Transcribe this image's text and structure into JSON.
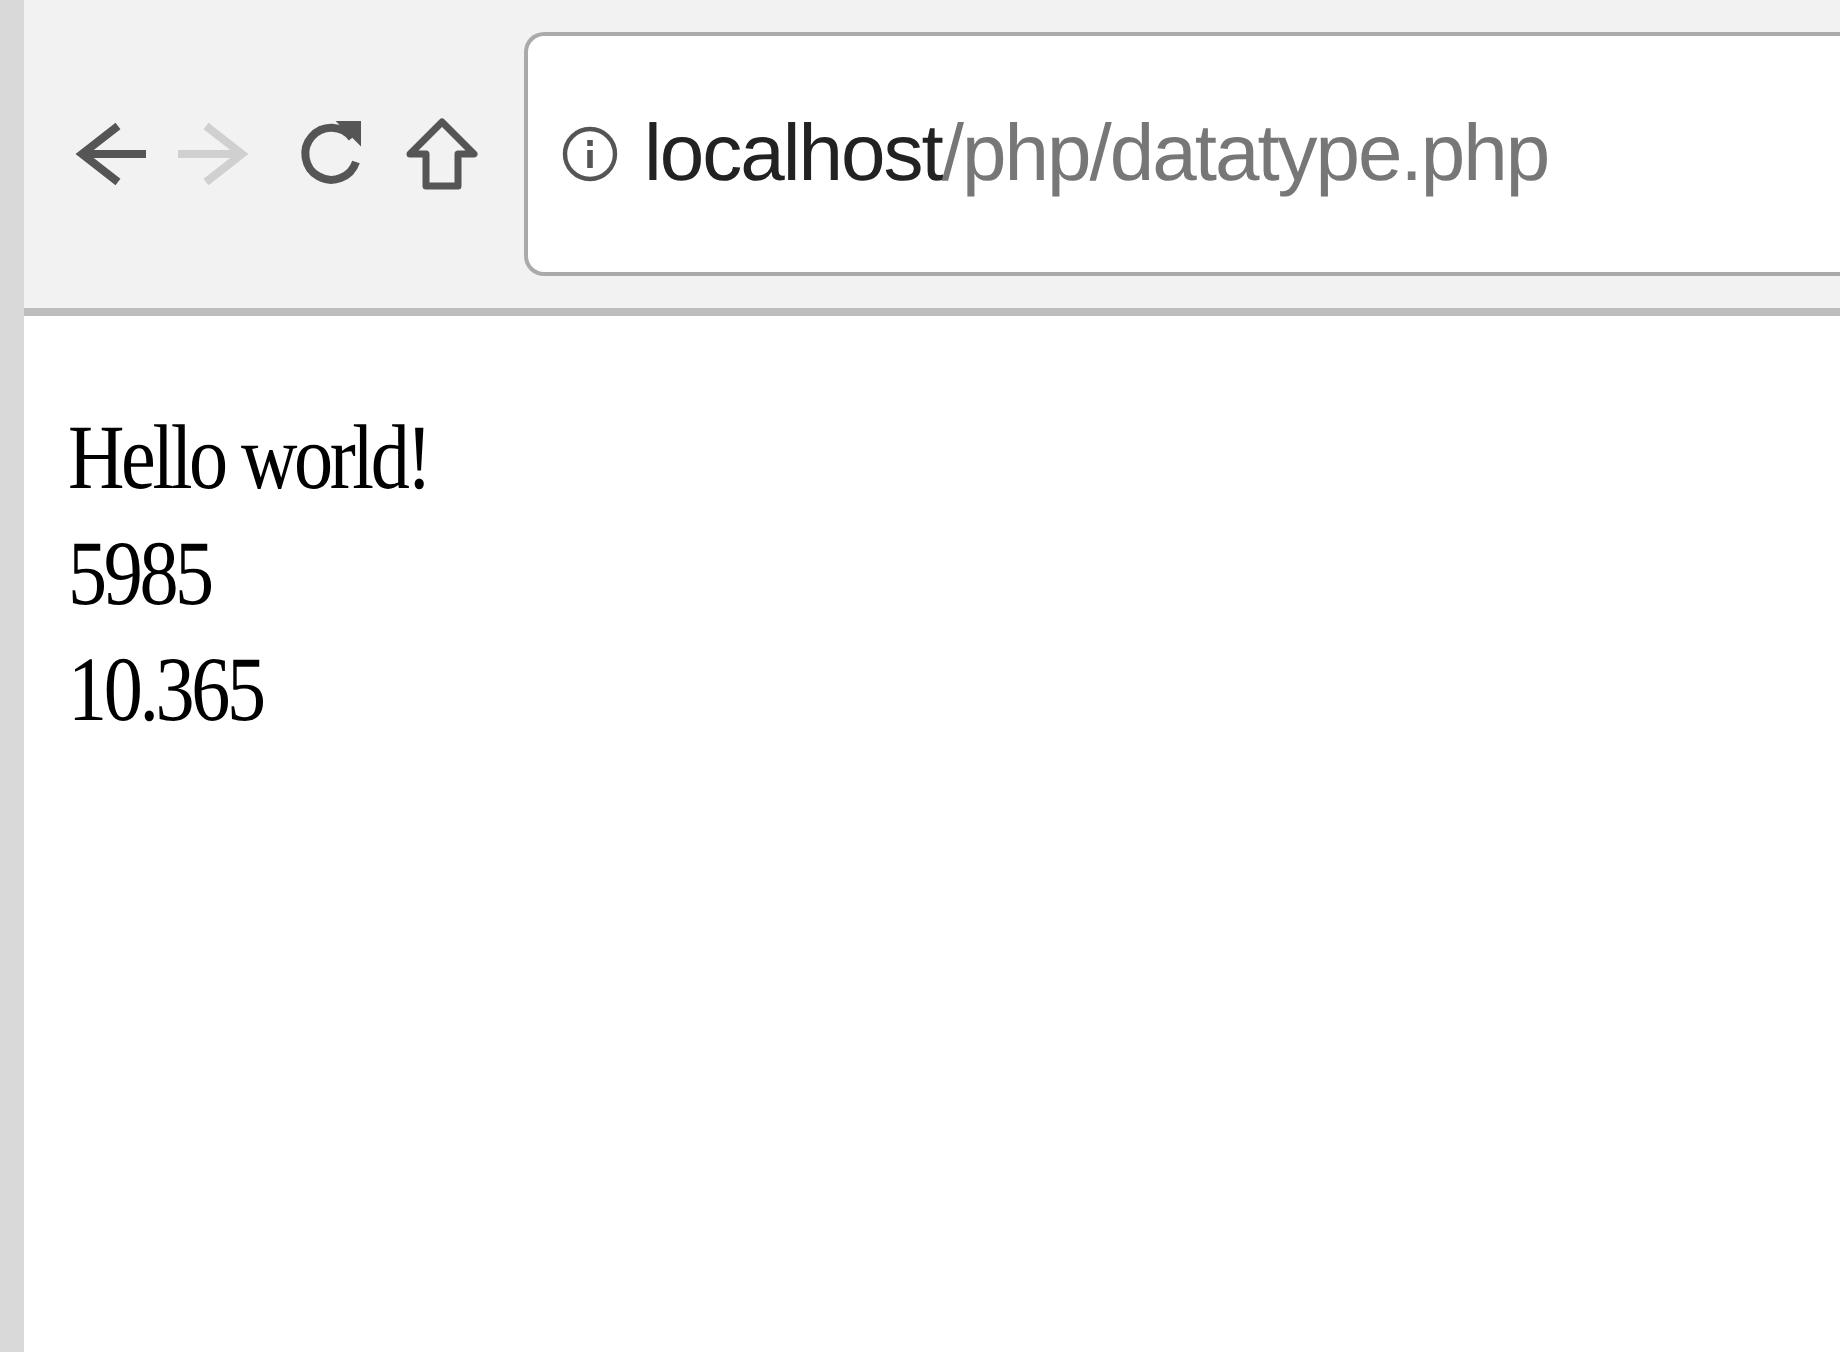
{
  "toolbar": {
    "nav_buttons": [
      {
        "kind": "back",
        "disabled": false
      },
      {
        "kind": "forward",
        "disabled": true
      },
      {
        "kind": "reload",
        "disabled": false
      },
      {
        "kind": "home",
        "disabled": false
      }
    ],
    "address": {
      "host": "localhost",
      "path": "/php/datatype.php"
    }
  },
  "content": {
    "lines": [
      "Hello world!",
      "5985",
      "10.365"
    ]
  }
}
